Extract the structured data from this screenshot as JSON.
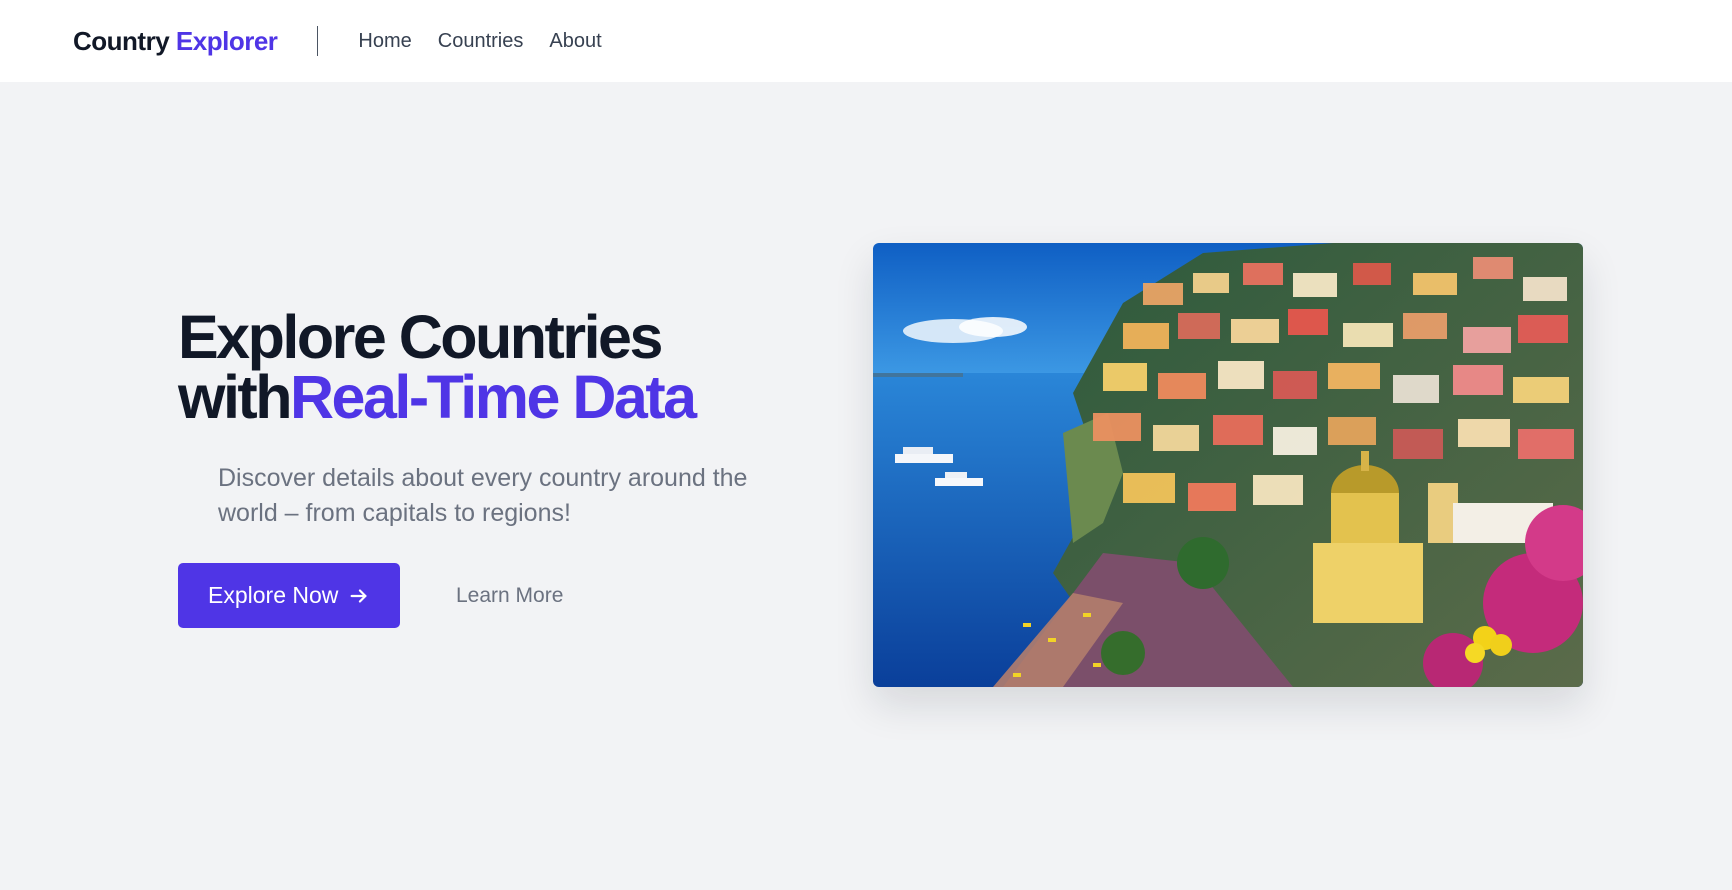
{
  "nav": {
    "brand_part1": "Country",
    "brand_part2": "Explorer",
    "links": [
      "Home",
      "Countries",
      "About"
    ]
  },
  "hero": {
    "title_line1": "Explore Countries",
    "title_line2_prefix": "with",
    "title_line2_accent": "Real-Time Data",
    "description": "Discover details about every country around the world – from capitals to regions!",
    "primary_button": "Explore Now",
    "secondary_button": "Learn More",
    "image_icon": "coastal-village-photo"
  },
  "colors": {
    "accent": "#4f35e6",
    "background": "#f2f3f5",
    "text_dark": "#111827",
    "text_muted": "#6b7280"
  }
}
